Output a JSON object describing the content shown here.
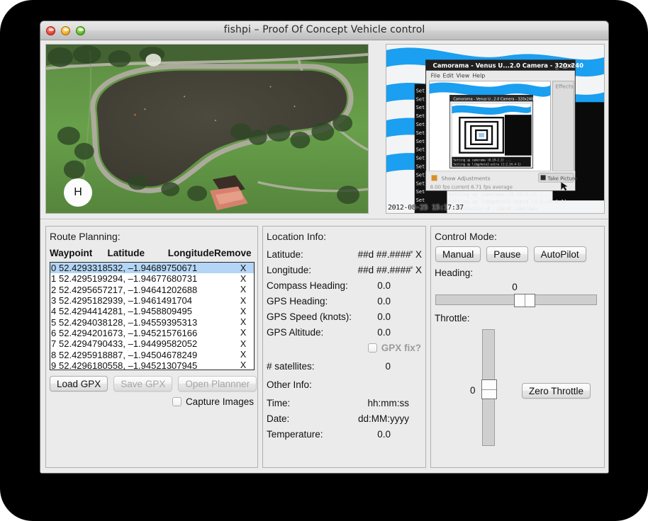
{
  "window": {
    "title": "fishpi – Proof Of Concept Vehicle control",
    "traffic_lights": [
      "close-button",
      "minimize-button",
      "zoom-button"
    ]
  },
  "media": {
    "map": {
      "marker_label": "H"
    },
    "camera": {
      "timestamp": "2012-08-25 15:17:37"
    }
  },
  "route_planning": {
    "title": "Route Planning:",
    "columns": [
      "Waypoint",
      "Latitude",
      "Longitude",
      "Remove"
    ],
    "remove_glyph": "X",
    "selected_index": 0,
    "waypoints": [
      {
        "index": "0",
        "coords": "52.4293318532, –1.94689750671"
      },
      {
        "index": "1",
        "coords": "52.4295199294, –1.94677680731"
      },
      {
        "index": "2",
        "coords": "52.4295657217, –1.94641202688"
      },
      {
        "index": "3",
        "coords": "52.4295182939, –1.9461491704"
      },
      {
        "index": "4",
        "coords": "52.4294414281, –1.9458809495"
      },
      {
        "index": "5",
        "coords": "52.4294038128, –1.94559395313"
      },
      {
        "index": "6",
        "coords": "52.4294201673, –1.94521576166"
      },
      {
        "index": "7",
        "coords": "52.4294790433, –1.94499582052"
      },
      {
        "index": "8",
        "coords": "52.4295918887, –1.94504678249"
      },
      {
        "index": "9",
        "coords": "52.4296180558, –1.94521307945"
      }
    ],
    "buttons": {
      "load_gpx": "Load GPX",
      "save_gpx": "Save GPX",
      "open_planner": "Open Plannner"
    },
    "capture_images_label": "Capture Images",
    "capture_images_checked": false
  },
  "location_info": {
    "title": "Location Info:",
    "rows": [
      {
        "label": "Latitude:",
        "value": "##d ##.####' X"
      },
      {
        "label": "Longitude:",
        "value": "##d ##.####' X"
      },
      {
        "label": "Compass Heading:",
        "value": "0.0"
      },
      {
        "label": "GPS Heading:",
        "value": "0.0"
      },
      {
        "label": "GPS Speed (knots):",
        "value": "0.0"
      },
      {
        "label": "GPS Altitude:",
        "value": "0.0"
      }
    ],
    "gpx_fix_label": "GPX fix?",
    "gpx_fix_checked": false,
    "satellites_label": "# satellites:",
    "satellites_value": "0",
    "other_info_title": "Other Info:",
    "other_rows": [
      {
        "label": "Time:",
        "value": "hh:mm:ss"
      },
      {
        "label": "Date:",
        "value": "dd:MM:yyyy"
      },
      {
        "label": "Temperature:",
        "value": "0.0"
      }
    ]
  },
  "control_mode": {
    "title": "Control Mode:",
    "modes": [
      "Manual",
      "Pause",
      "AutoPilot"
    ],
    "heading_label": "Heading:",
    "heading_value": "0",
    "throttle_label": "Throttle:",
    "throttle_value": "0",
    "zero_throttle_label": "Zero Throttle"
  },
  "colors": {
    "selection_blue": "#b4d5f5",
    "window_bg": "#ebebeb",
    "panel_border": "#b0b0b0"
  }
}
